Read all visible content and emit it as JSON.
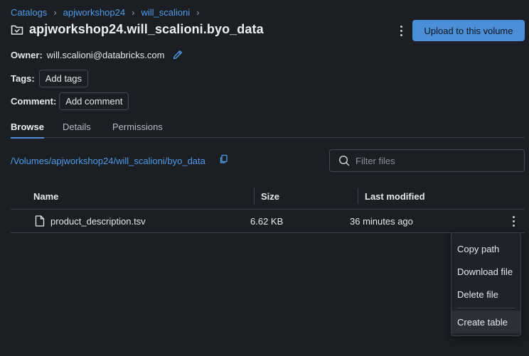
{
  "breadcrumb": {
    "items": [
      "Catalogs",
      "apjworkshop24",
      "will_scalioni"
    ],
    "separator": "›"
  },
  "header": {
    "title": "apjworkshop24.will_scalioni.byo_data",
    "upload_button": "Upload to this volume"
  },
  "owner": {
    "label": "Owner:",
    "value": "will.scalioni@databricks.com"
  },
  "tags": {
    "label": "Tags:",
    "button": "Add tags"
  },
  "comment": {
    "label": "Comment:",
    "button": "Add comment"
  },
  "tabs": [
    {
      "label": "Browse",
      "active": true
    },
    {
      "label": "Details",
      "active": false
    },
    {
      "label": "Permissions",
      "active": false
    }
  ],
  "path": "/Volumes/apjworkshop24/will_scalioni/byo_data",
  "filter": {
    "placeholder": "Filter files"
  },
  "table": {
    "columns": [
      "Name",
      "Size",
      "Last modified"
    ],
    "rows": [
      {
        "name": "product_description.tsv",
        "size": "6.62 KB",
        "modified": "36 minutes ago"
      }
    ]
  },
  "context_menu": {
    "items": [
      "Copy path",
      "Download file",
      "Delete file"
    ],
    "footer_item": "Create table"
  },
  "colors": {
    "background": "#1b1f24",
    "accent": "#4a8fd8",
    "link": "#4f9be8",
    "border": "#3a4047"
  }
}
